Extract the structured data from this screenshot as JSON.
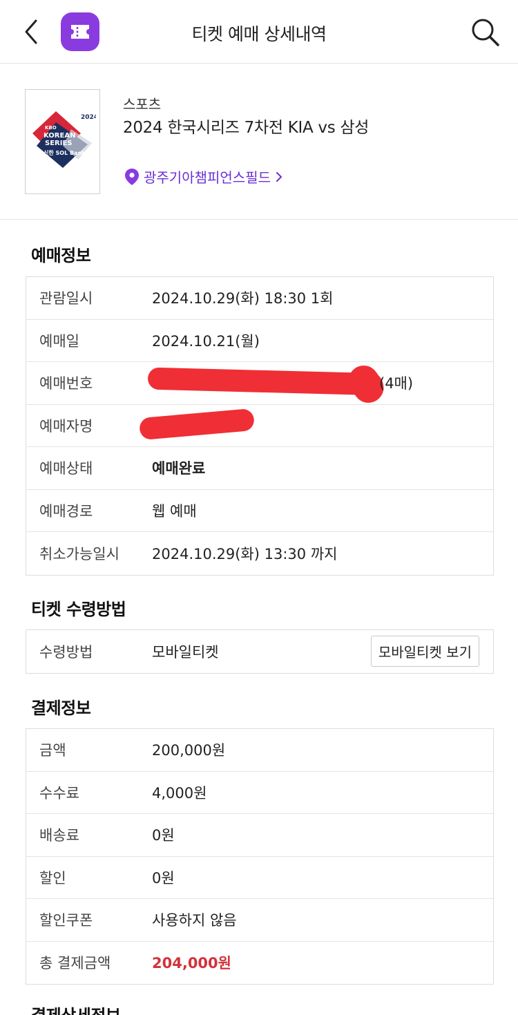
{
  "header": {
    "title": "티켓 예매 상세내역",
    "badge_color": "#8a3be0"
  },
  "event": {
    "category": "스포츠",
    "name": "2024 한국시리즈 7차전 KIA vs 삼성",
    "venue": "광주기아챔피언스필드",
    "poster": {
      "year": "2024",
      "brand": "KBO",
      "line1": "KOREAN",
      "line2": "SERIES",
      "sponsor": "신한 SOL Bank"
    }
  },
  "booking": {
    "title": "예매정보",
    "rows": [
      {
        "label": "관람일시",
        "value": "2024.10.29(화) 18:30 1회"
      },
      {
        "label": "예매일",
        "value": "2024.10.21(월)"
      },
      {
        "label": "예매번호",
        "value": "(4매)"
      },
      {
        "label": "예매자명",
        "value": ""
      },
      {
        "label": "예매상태",
        "value": "예매완료"
      },
      {
        "label": "예매경로",
        "value": "웹 예매"
      },
      {
        "label": "취소가능일시",
        "value": "2024.10.29(화) 13:30 까지"
      }
    ]
  },
  "receipt": {
    "title": "티켓 수령방법",
    "label": "수령방법",
    "value": "모바일티켓",
    "button": "모바일티켓 보기"
  },
  "payment": {
    "title": "결제정보",
    "rows": [
      {
        "label": "금액",
        "value": "200,000원"
      },
      {
        "label": "수수료",
        "value": "4,000원"
      },
      {
        "label": "배송료",
        "value": "0원"
      },
      {
        "label": "할인",
        "value": "0원"
      },
      {
        "label": "할인쿠폰",
        "value": "사용하지 않음"
      },
      {
        "label": "총 결제금액",
        "value": "204,000원"
      }
    ],
    "total_color": "#d2333a"
  },
  "next_section": {
    "title": "결제상세정보"
  }
}
